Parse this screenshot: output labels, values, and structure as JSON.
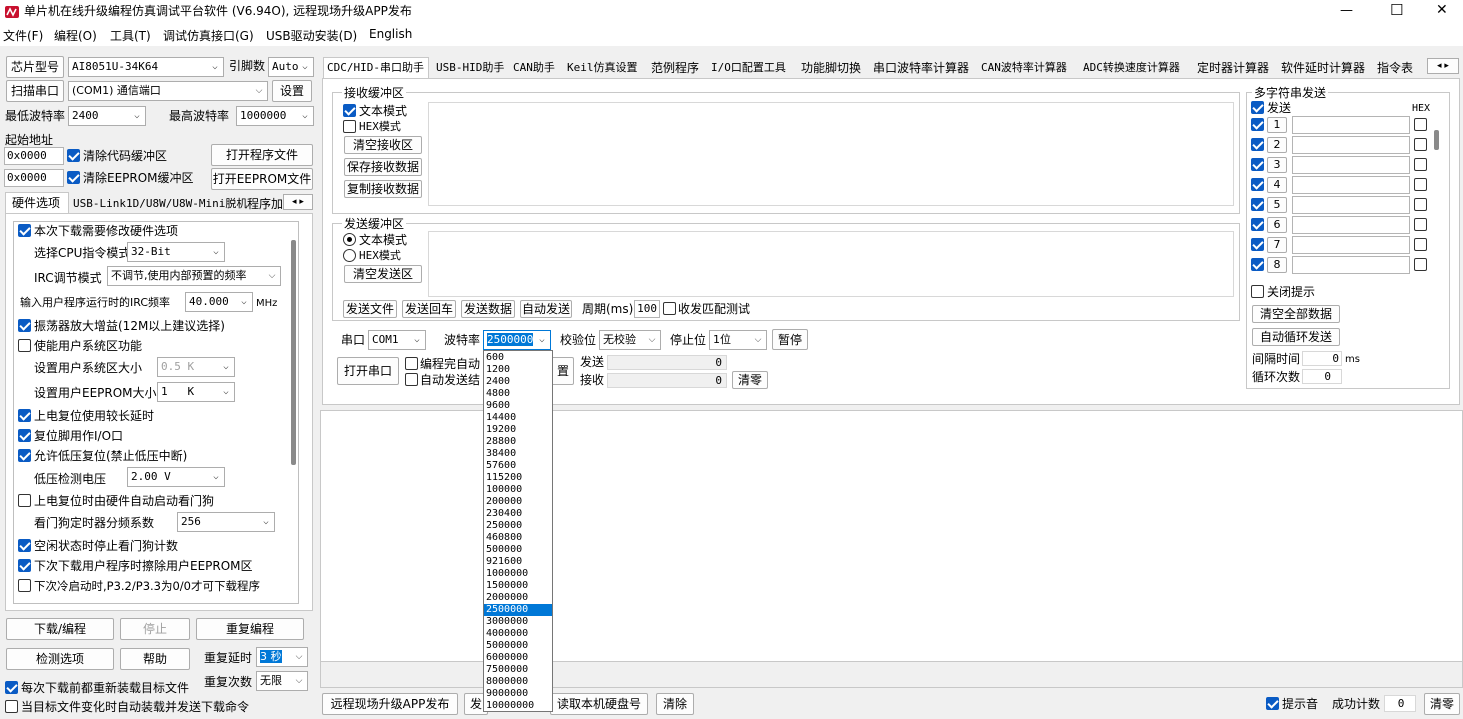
{
  "window": {
    "title": "单片机在线升级编程仿真调试平台软件 (V6.94O), 远程现场升级APP发布",
    "min_symbol": "—",
    "max_symbol": "☐",
    "close_symbol": "✕"
  },
  "menu": [
    "文件(F)",
    "编程(O)",
    "工具(T)",
    "调试仿真接口(G)",
    "USB驱动安装(D)",
    "English"
  ],
  "left": {
    "chip_btn": "芯片型号",
    "chip_value": "AI8051U-34K64",
    "pin_label": "引脚数",
    "pin_value": "Auto",
    "scan_btn": "扫描串口",
    "port_value": "(COM1) 通信端口",
    "settings_btn": "设置",
    "min_baud_label": "最低波特率",
    "min_baud_value": "2400",
    "max_baud_label": "最高波特率",
    "max_baud_value": "1000000",
    "start_addr_label": "起始地址",
    "addr1": "0x0000",
    "clear_code_label": "清除代码缓冲区",
    "open_prog_btn": "打开程序文件",
    "addr2": "0x0000",
    "clear_eeprom_label": "清除EEPROM缓冲区",
    "open_eeprom_btn": "打开EEPROM文件",
    "tabs": [
      "硬件选项",
      "USB-Link1D/U8W/U8W-Mini脱机",
      "程序加"
    ],
    "hw": {
      "opt1": "本次下载需要修改硬件选项",
      "cpu_label": "选择CPU指令模式",
      "cpu_value": "32-Bit",
      "irc_label": "IRC调节模式",
      "irc_value": "不调节,使用内部预置的频率",
      "freq_label": "输入用户程序运行时的IRC频率",
      "freq_value": "40.000",
      "freq_unit": "MHz",
      "opt2": "振荡器放大增益(12M以上建议选择)",
      "opt3": "使能用户系统区功能",
      "sys_size_label": "设置用户系统区大小",
      "sys_size_value": "0.5 K",
      "eeprom_size_label": "设置用户EEPROM大小",
      "eeprom_size_value": "1   K",
      "opt4": "上电复位使用较长延时",
      "opt5": "复位脚用作I/O口",
      "opt6": "允许低压复位(禁止低压中断)",
      "lvd_label": "低压检测电压",
      "lvd_value": "2.00 V",
      "opt7": "上电复位时由硬件自动启动看门狗",
      "wdt_label": "看门狗定时器分频系数",
      "wdt_value": "256",
      "opt8": "空闲状态时停止看门狗计数",
      "opt9": "下次下载用户程序时擦除用户EEPROM区",
      "opt10": "下次冷启动时,P3.2/P3.3为0/0才可下载程序"
    },
    "download_btn": "下载/编程",
    "stop_btn": "停止",
    "reprog_btn": "重复编程",
    "detect_btn": "检测选项",
    "help_btn": "帮助",
    "delay_label": "重复延时",
    "delay_value": "3 秒",
    "count_label": "重复次数",
    "count_value": "无限",
    "reload_label": "每次下载前都重新装载目标文件",
    "auto_label": "当目标文件变化时自动装载并发送下载命令"
  },
  "tabs": [
    "CDC/HID-串口助手",
    "USB-HID助手",
    "CAN助手",
    "Keil仿真设置",
    "范例程序",
    "I/O口配置工具",
    "功能脚切换",
    "串口波特率计算器",
    "CAN波特率计算器",
    "ADC转换速度计算器",
    "定时器计算器",
    "软件延时计算器",
    "指令表"
  ],
  "serial": {
    "recv_group": "接收缓冲区",
    "recv_text_mode": "文本模式",
    "recv_hex_mode": "HEX模式",
    "clear_recv_btn": "清空接收区",
    "save_recv_btn": "保存接收数据",
    "copy_recv_btn": "复制接收数据",
    "send_group": "发送缓冲区",
    "send_text_mode": "文本模式",
    "send_hex_mode": "HEX模式",
    "clear_send_btn": "清空发送区",
    "send_file_btn": "发送文件",
    "send_enter_btn": "发送回车",
    "send_data_btn": "发送数据",
    "auto_send_btn": "自动发送",
    "period_label": "周期(ms)",
    "period_value": "100",
    "match_label": "收发匹配测试",
    "port_label": "串口",
    "port_value": "COM1",
    "baud_label": "波特率",
    "baud_value": "2500000",
    "parity_label": "校验位",
    "parity_value": "无校验",
    "stop_label": "停止位",
    "stop_value": "1位",
    "pause_btn": "暂停",
    "open_port_btn": "打开串口",
    "prog_done_label": "编程完自动",
    "auto_send_end_label": "自动发送结",
    "partial_btn": "置",
    "send_count_label": "发送",
    "send_count": "0",
    "recv_count_label": "接收",
    "recv_count": "0",
    "clear_count_btn": "清零",
    "baud_options": [
      "600",
      "1200",
      "2400",
      "4800",
      "9600",
      "14400",
      "19200",
      "28800",
      "38400",
      "57600",
      "115200",
      "100000",
      "200000",
      "230400",
      "250000",
      "460800",
      "500000",
      "921600",
      "1000000",
      "1500000",
      "2000000",
      "2500000",
      "3000000",
      "4000000",
      "5000000",
      "6000000",
      "7500000",
      "8000000",
      "9000000",
      "10000000"
    ]
  },
  "multi": {
    "group": "多字符串发送",
    "send_label": "发送",
    "hex_label": "HEX",
    "rows": [
      "1",
      "2",
      "3",
      "4",
      "5",
      "6",
      "7",
      "8"
    ],
    "close_hint": "关闭提示",
    "clear_all_btn": "清空全部数据",
    "auto_loop_btn": "自动循环发送",
    "interval_label": "间隔时间",
    "interval_value": "0",
    "interval_unit": "ms",
    "loop_label": "循环次数",
    "loop_value": "0"
  },
  "bottom": {
    "publish_btn": "远程现场升级APP发布",
    "partial_btn": "发",
    "read_disk_btn": "读取本机硬盘号",
    "clear_btn": "清除",
    "beep_label": "提示音",
    "success_label": "成功计数",
    "success_value": "0",
    "clear_zero_btn": "清零"
  }
}
